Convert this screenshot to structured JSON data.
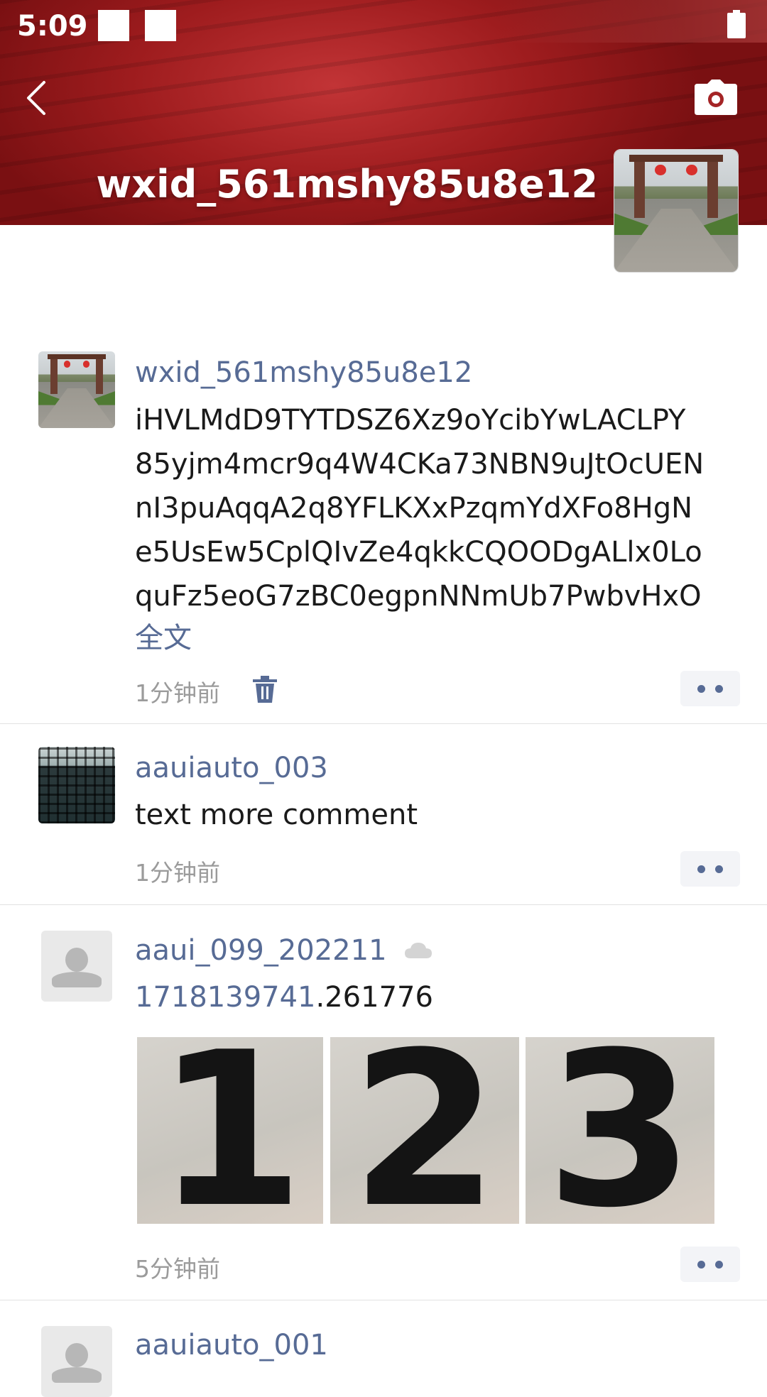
{
  "status_bar": {
    "time": "5:09"
  },
  "header": {
    "username": "wxid_561mshy85u8e12",
    "icons": {
      "back": "back-arrow-icon",
      "camera": "camera-icon",
      "battery": "battery-icon"
    }
  },
  "posts": [
    {
      "nickname": "wxid_561mshy85u8e12",
      "text": "iHVLMdD9TYTDSZ6Xz9oYcibYwLACLPY\n85yjm4mcr9q4W4CKa73NBN9uJtOcUEN\nnI3puAqqA2q8YFLKXxPzqmYdXFo8HgN\ne5UsEw5CplQIvZe4qkkCQOODgALlx0Lo\nquFz5eoG7zBC0egpnNNmUb7PwbvHxO",
      "full_text_link": "全文",
      "time": "1分钟前",
      "icons": [
        "trash-icon",
        "more-dots-icon"
      ]
    },
    {
      "nickname": "aauiauto_003",
      "text": "text more comment",
      "time": "1分钟前",
      "icons": [
        "more-dots-icon"
      ]
    },
    {
      "nickname": "aaui_099_202211",
      "text_link": "1718139741",
      "text_rest": ".261776",
      "photos": [
        "1",
        "2",
        "3"
      ],
      "time": "5分钟前",
      "icons": [
        "cloud-icon",
        "more-dots-icon"
      ]
    },
    {
      "nickname": "aauiauto_001"
    }
  ],
  "colors": {
    "link": "#576b95",
    "time": "#9b9b9b",
    "cover": "#a82426"
  }
}
